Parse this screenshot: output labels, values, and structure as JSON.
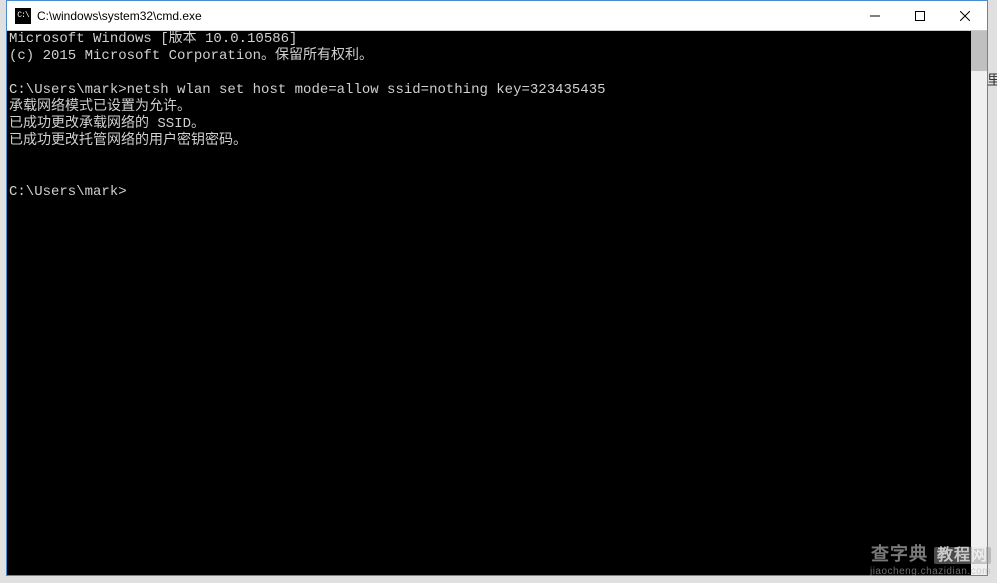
{
  "window": {
    "title": "C:\\windows\\system32\\cmd.exe",
    "icon_label": "cmd-icon"
  },
  "terminal": {
    "lines": [
      "Microsoft Windows [版本 10.0.10586]",
      "(c) 2015 Microsoft Corporation。保留所有权利。",
      "",
      "C:\\Users\\mark>netsh wlan set host mode=allow ssid=nothing key=323435435",
      "承载网络模式已设置为允许。",
      "已成功更改承载网络的 SSID。",
      "已成功更改托管网络的用户密钥密码。",
      "",
      "",
      "C:\\Users\\mark>"
    ]
  },
  "watermark": {
    "main_prefix": "查字典",
    "main_suffix": "教程网",
    "sub": "jiaocheng.chazidian.com"
  },
  "side_char": "里"
}
